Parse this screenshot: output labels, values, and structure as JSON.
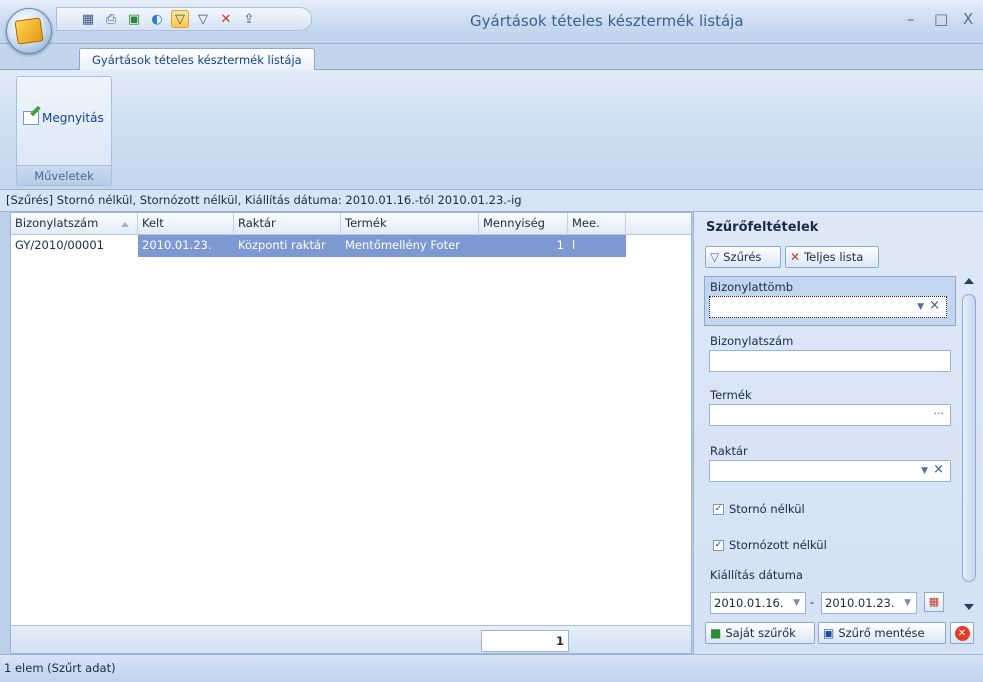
{
  "window": {
    "title": "Gyártások tételes késztermék listája",
    "minimize": "–",
    "maximize": "□",
    "close": "X"
  },
  "quick_access": [
    "table-icon",
    "print-icon",
    "excel-icon",
    "chart-icon",
    "filter-icon",
    "filter-light-icon",
    "filter-remove-icon",
    "export-icon"
  ],
  "tabs": [
    {
      "label": "Gyártások tételes késztermék listája"
    }
  ],
  "ribbon": {
    "open_label": "Megnyitás",
    "group_label": "Műveletek"
  },
  "filter_status": "[Szűrés]  Stornó nélkül, Stornózott nélkül, Kiállítás dátuma: 2010.01.16.-tól  2010.01.23.-ig",
  "grid": {
    "columns": [
      "Bizonylatszám",
      "Kelt",
      "Raktár",
      "Termék",
      "Mennyiség",
      "Mee."
    ],
    "rows": [
      [
        "GY/2010/00001",
        "2010.01.23.",
        "Központi raktár",
        "Mentőmellény Foter",
        "1",
        "l"
      ]
    ],
    "footer_total": "1"
  },
  "panel": {
    "title": "Szűrőfeltételek",
    "filter_button": "Szűrés",
    "full_list_button": "Teljes lista",
    "fields": {
      "bizonylattomb": "Bizonylattömb",
      "bizonylatszam": "Bizonylatszám",
      "termek": "Termék",
      "raktar": "Raktár"
    },
    "checkboxes": [
      {
        "label": "Stornó nélkül",
        "checked": true
      },
      {
        "label": "Stornózott nélkül",
        "checked": true
      }
    ],
    "date_label": "Kiállítás dátuma",
    "date_from": "2010.01.16.",
    "date_to": "2010.01.23.",
    "date_sep": "-",
    "own_filters_button": "Saját szűrők",
    "save_filter_button": "Szűrő mentése"
  },
  "status_bar": "1 elem (Szűrt adat)"
}
